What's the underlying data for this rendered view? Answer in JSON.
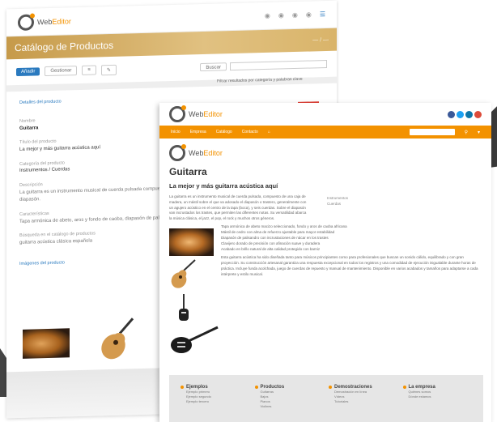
{
  "brand": {
    "name_a": "Web",
    "name_b": "Editor",
    "accent": "#f39200",
    "blue": "#2a7abf"
  },
  "admin": {
    "banner_title": "Catálogo de Productos",
    "banner_right": "— / —",
    "toolbar": {
      "new_label": "Añadir",
      "manage_label": "Gestionar",
      "b3": "≡",
      "b4": "✎"
    },
    "search_select": "Buscar",
    "filter_note": "Filtrar resultados por categoría y palabras clave",
    "panel_title": "Detalles del producto",
    "fields": [
      {
        "label": "Nombre",
        "value": "Guitarra"
      },
      {
        "label": "Título del producto",
        "value": "La mejor y más guitarra acústica aquí"
      },
      {
        "label": "Categoría del producto",
        "value": "Instrumentos / Cuerdas"
      },
      {
        "label": "Descripción",
        "value": "La guitarra es un instrumento musical de cuerda pulsada compuesto de una caja de madera y un mástil sobre el que va adosado el diapasón."
      },
      {
        "label": "Características",
        "value": "Tapa armónica de abeto, aros y fondo de caoba, diapasón de palisandro, clavijero dorado, acabado en brillo natural."
      },
      {
        "label": "Búsqueda en el catálogo de productos",
        "value": "guitarra acústica clásica española"
      }
    ],
    "images_label": "Imágenes del producto"
  },
  "site": {
    "nav": [
      "Inicio",
      "Empresa",
      "Catálogo",
      "Contacto",
      "⌂"
    ],
    "product_title": "Guitarra",
    "product_subtitle": "La mejor y más guitarra acústica aquí",
    "description": "La guitarra es un instrumento musical de cuerda pulsada, compuesto de una caja de madera, un mástil sobre el que va adosado el diapasón o trastero, generalmente con un agujero acústico en el centro de la tapa (boca), y seis cuerdas. Sobre el diapasón van incrustados los trastes, que permiten las diferentes notas. Su versatilidad abarca la música clásica, el jazz, el pop, el rock y muchos otros géneros.",
    "side": [
      "Instrumentos",
      "Cuerdas"
    ],
    "features": [
      "Tapa armónica de abeto macizo seleccionado, fondo y aros de caoba africana",
      "Mástil de cedro con alma de refuerzo ajustable para mayor estabilidad",
      "Diapasón de palisandro con incrustaciones de nácar en los trastes",
      "Clavijero dorado de precisión con afinación suave y duradera",
      "Acabado en brillo natural de alta calidad protegido con barniz"
    ],
    "body": "Esta guitarra acústica ha sido diseñada tanto para músicos principiantes como para profesionales que buscan un sonido cálido, equilibrado y con gran proyección. Su construcción artesanal garantiza una respuesta excepcional en todos los registros y una comodidad de ejecución inigualable durante horas de práctica. Incluye funda acolchada, juego de cuerdas de repuesto y manual de mantenimiento. Disponible en varios acabados y tamaños para adaptarse a cada intérprete y estilo musical.",
    "footer": [
      {
        "title": "Ejemplos",
        "items": [
          "Ejemplo primero",
          "Ejemplo segundo",
          "Ejemplo tercero"
        ]
      },
      {
        "title": "Productos",
        "items": [
          "Guitarras",
          "Bajos",
          "Pianos",
          "Violines"
        ]
      },
      {
        "title": "Demostraciones",
        "items": [
          "Demostración en línea",
          "Vídeos",
          "Tutoriales"
        ]
      },
      {
        "title": "La empresa",
        "items": [
          "Quiénes somos",
          "Dónde estamos"
        ]
      }
    ],
    "social_colors": [
      "#3b5998",
      "#1da1f2",
      "#0e76a8",
      "#dd4b39"
    ]
  }
}
